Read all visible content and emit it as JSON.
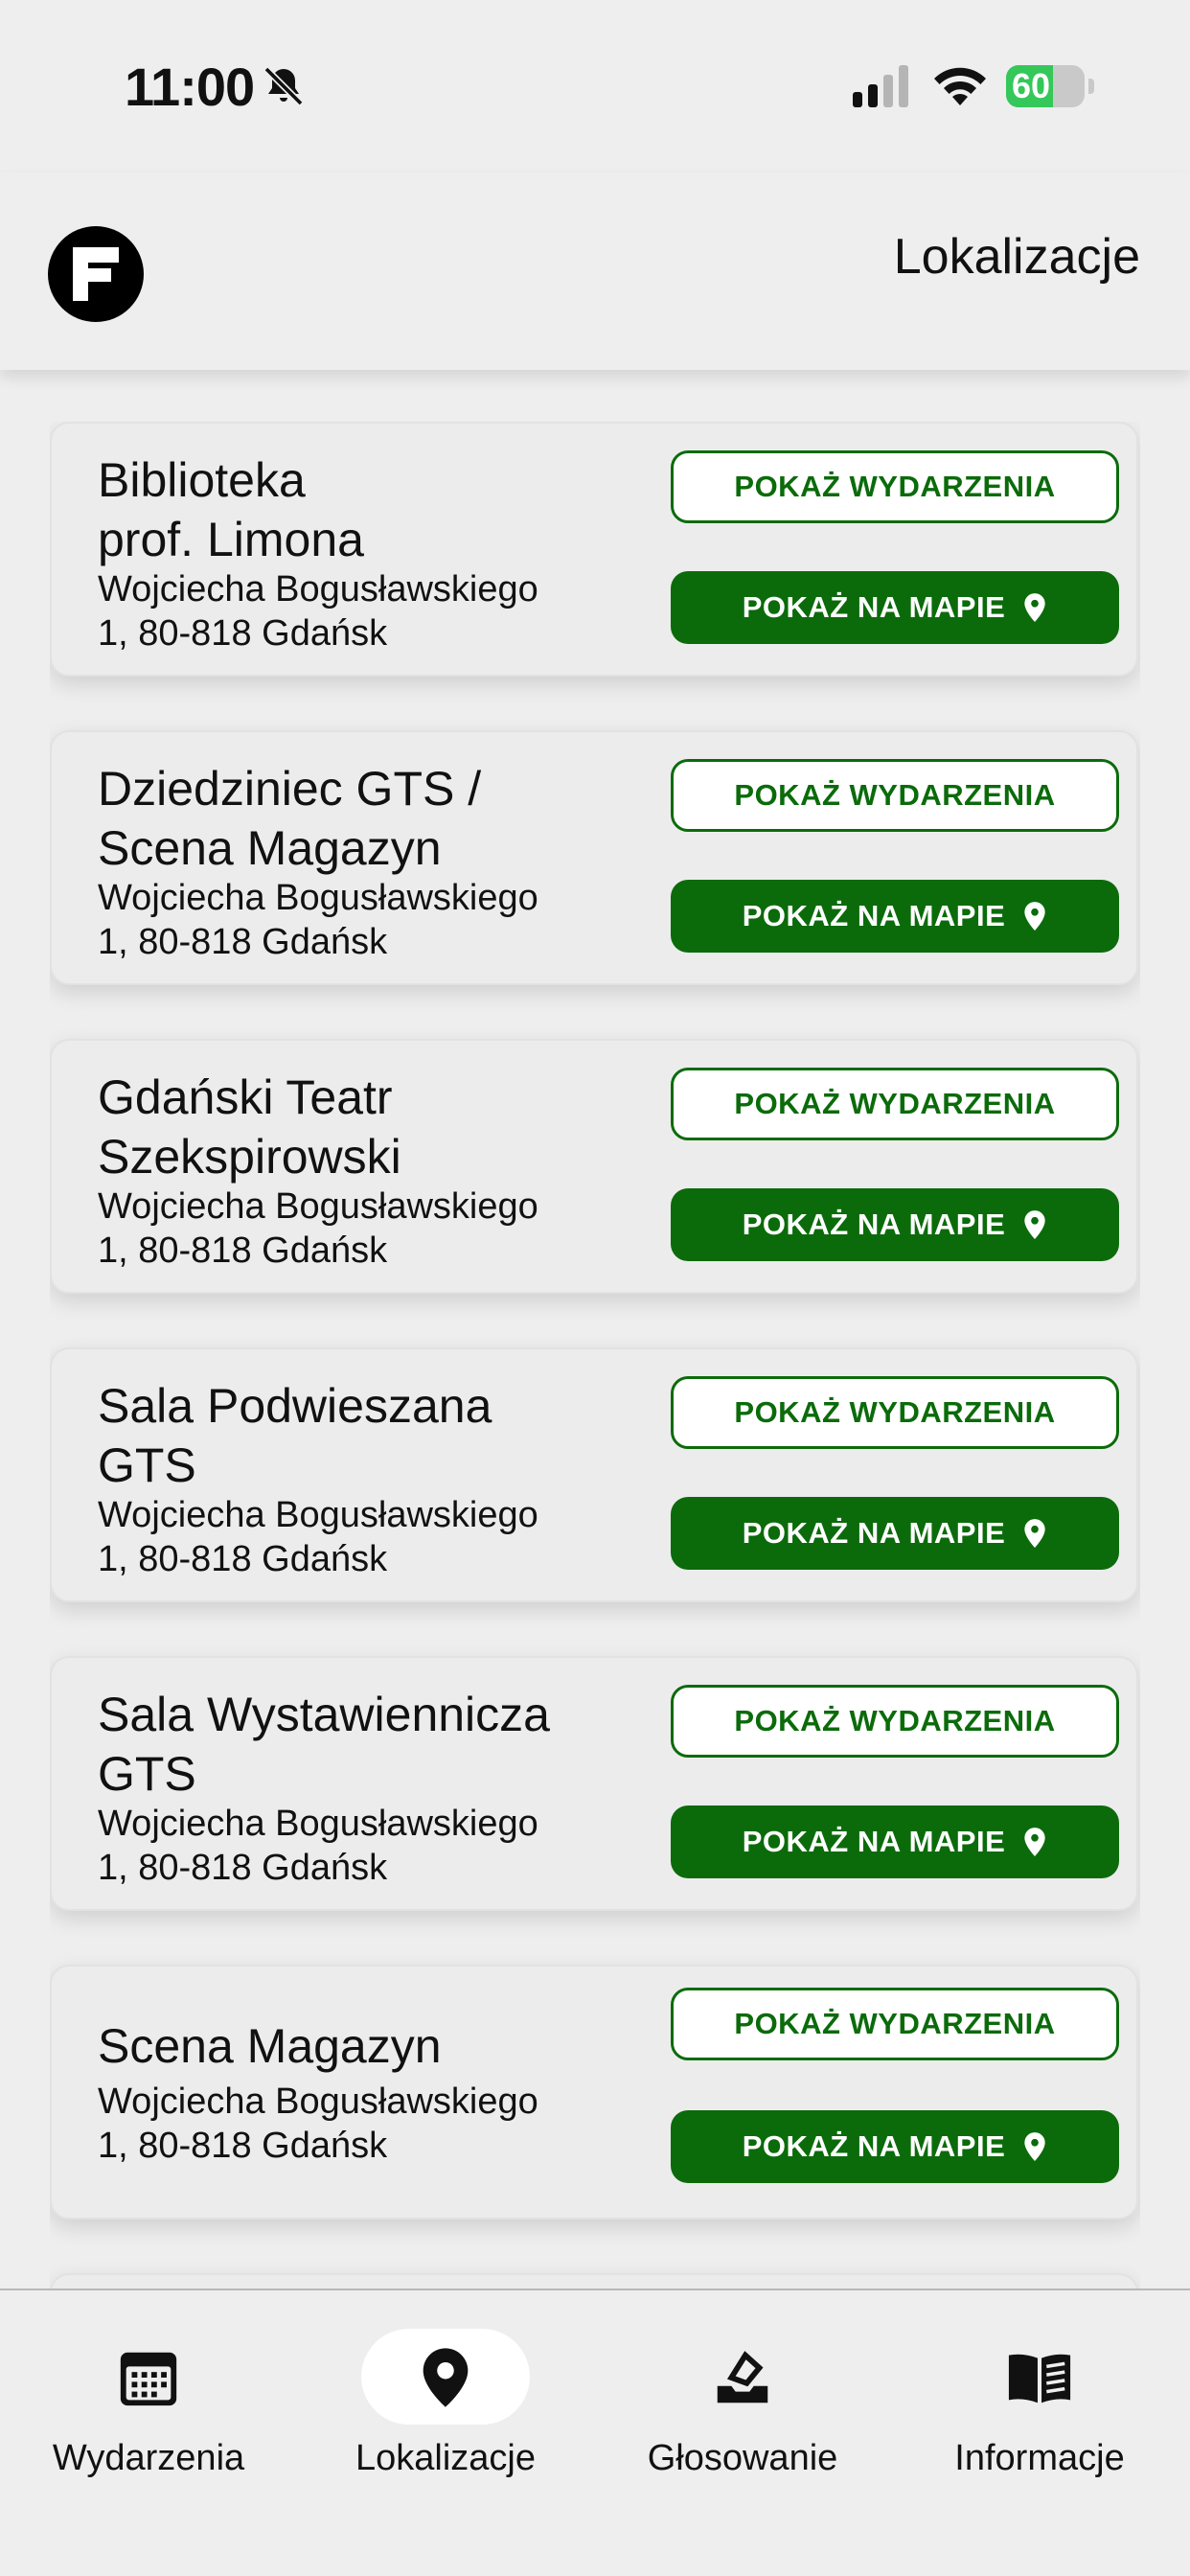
{
  "status_bar": {
    "time": "11:00",
    "battery_level": "60",
    "battery_percent": 60,
    "icons": [
      "bell-slash-icon",
      "signal-icon",
      "wifi-icon",
      "battery-charging-icon"
    ]
  },
  "header": {
    "logo_icon": "f-logo-icon",
    "title": "Lokalizacje"
  },
  "colors": {
    "accent_green": "#0b6b0b",
    "background": "#eeeeee",
    "battery_green": "#34c759"
  },
  "locations": [
    {
      "name": "Biblioteka prof. Limona",
      "name_lines": [
        "Biblioteka",
        "prof. Limona"
      ],
      "address_lines": [
        "Wojciecha Bogusławskiego",
        "1, 80-818 Gdańsk"
      ],
      "events_label": "POKAŻ WYDARZENIA",
      "map_label": "POKAŻ NA MAPIE"
    },
    {
      "name": "Dziedziniec GTS / Scena Magazyn",
      "name_lines": [
        "Dziedziniec GTS /",
        "Scena Magazyn"
      ],
      "address_lines": [
        "Wojciecha Bogusławskiego",
        "1, 80-818 Gdańsk"
      ],
      "events_label": "POKAŻ WYDARZENIA",
      "map_label": "POKAŻ NA MAPIE"
    },
    {
      "name": "Gdański Teatr Szekspirowski",
      "name_lines": [
        "Gdański Teatr",
        "Szekspirowski"
      ],
      "address_lines": [
        "Wojciecha Bogusławskiego",
        "1, 80-818 Gdańsk"
      ],
      "events_label": "POKAŻ WYDARZENIA",
      "map_label": "POKAŻ NA MAPIE"
    },
    {
      "name": "Sala Podwieszana GTS",
      "name_lines": [
        "Sala Podwieszana",
        "GTS"
      ],
      "address_lines": [
        "Wojciecha Bogusławskiego",
        "1, 80-818 Gdańsk"
      ],
      "events_label": "POKAŻ WYDARZENIA",
      "map_label": "POKAŻ NA MAPIE"
    },
    {
      "name": "Sala Wystawiennicza GTS",
      "name_lines": [
        "Sala Wystawiennicza",
        "GTS"
      ],
      "address_lines": [
        "Wojciecha Bogusławskiego",
        "1, 80-818 Gdańsk"
      ],
      "events_label": "POKAŻ WYDARZENIA",
      "map_label": "POKAŻ NA MAPIE"
    },
    {
      "name": "Scena Magazyn",
      "name_lines": [
        "Scena Magazyn"
      ],
      "address_lines": [
        "Wojciecha Bogusławskiego",
        "1, 80-818 Gdańsk"
      ],
      "events_label": "POKAŻ WYDARZENIA",
      "map_label": "POKAŻ NA MAPIE"
    }
  ],
  "bottom_nav": {
    "items": [
      {
        "label": "Wydarzenia",
        "icon": "calendar-icon",
        "active": false
      },
      {
        "label": "Lokalizacje",
        "icon": "location-pin-icon",
        "active": true
      },
      {
        "label": "Głosowanie",
        "icon": "ballot-box-icon",
        "active": false
      },
      {
        "label": "Informacje",
        "icon": "open-book-icon",
        "active": false
      }
    ]
  }
}
